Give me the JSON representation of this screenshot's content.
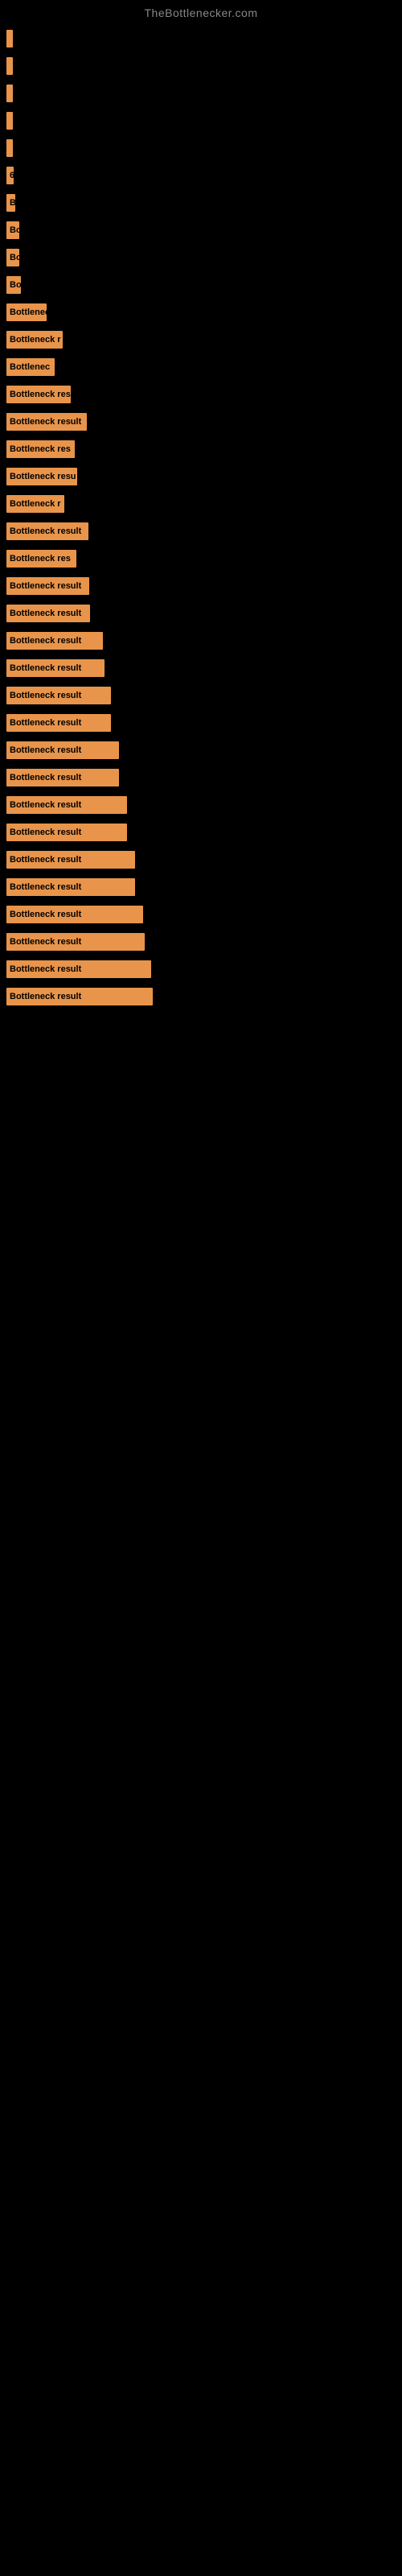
{
  "site": {
    "title": "TheBottlenecker.com"
  },
  "bars": [
    {
      "id": 1,
      "width": 8,
      "label": ""
    },
    {
      "id": 2,
      "width": 8,
      "label": ""
    },
    {
      "id": 3,
      "width": 8,
      "label": ""
    },
    {
      "id": 4,
      "width": 8,
      "label": ""
    },
    {
      "id": 5,
      "width": 8,
      "label": ""
    },
    {
      "id": 6,
      "width": 9,
      "label": "6"
    },
    {
      "id": 7,
      "width": 11,
      "label": "B"
    },
    {
      "id": 8,
      "width": 16,
      "label": "Bo"
    },
    {
      "id": 9,
      "width": 16,
      "label": "Bo"
    },
    {
      "id": 10,
      "width": 18,
      "label": "Bo"
    },
    {
      "id": 11,
      "width": 50,
      "label": "Bottlenec"
    },
    {
      "id": 12,
      "width": 70,
      "label": "Bottleneck r"
    },
    {
      "id": 13,
      "width": 60,
      "label": "Bottlenec"
    },
    {
      "id": 14,
      "width": 80,
      "label": "Bottleneck res"
    },
    {
      "id": 15,
      "width": 100,
      "label": "Bottleneck result"
    },
    {
      "id": 16,
      "width": 85,
      "label": "Bottleneck res"
    },
    {
      "id": 17,
      "width": 88,
      "label": "Bottleneck resu"
    },
    {
      "id": 18,
      "width": 72,
      "label": "Bottleneck r"
    },
    {
      "id": 19,
      "width": 102,
      "label": "Bottleneck result"
    },
    {
      "id": 20,
      "width": 87,
      "label": "Bottleneck res"
    },
    {
      "id": 21,
      "width": 103,
      "label": "Bottleneck result"
    },
    {
      "id": 22,
      "width": 104,
      "label": "Bottleneck result"
    },
    {
      "id": 23,
      "width": 120,
      "label": "Bottleneck result"
    },
    {
      "id": 24,
      "width": 122,
      "label": "Bottleneck result"
    },
    {
      "id": 25,
      "width": 130,
      "label": "Bottleneck result"
    },
    {
      "id": 26,
      "width": 130,
      "label": "Bottleneck result"
    },
    {
      "id": 27,
      "width": 140,
      "label": "Bottleneck result"
    },
    {
      "id": 28,
      "width": 140,
      "label": "Bottleneck result"
    },
    {
      "id": 29,
      "width": 150,
      "label": "Bottleneck result"
    },
    {
      "id": 30,
      "width": 150,
      "label": "Bottleneck result"
    },
    {
      "id": 31,
      "width": 160,
      "label": "Bottleneck result"
    },
    {
      "id": 32,
      "width": 160,
      "label": "Bottleneck result"
    },
    {
      "id": 33,
      "width": 170,
      "label": "Bottleneck result"
    },
    {
      "id": 34,
      "width": 172,
      "label": "Bottleneck result"
    },
    {
      "id": 35,
      "width": 180,
      "label": "Bottleneck result"
    },
    {
      "id": 36,
      "width": 182,
      "label": "Bottleneck result"
    }
  ]
}
